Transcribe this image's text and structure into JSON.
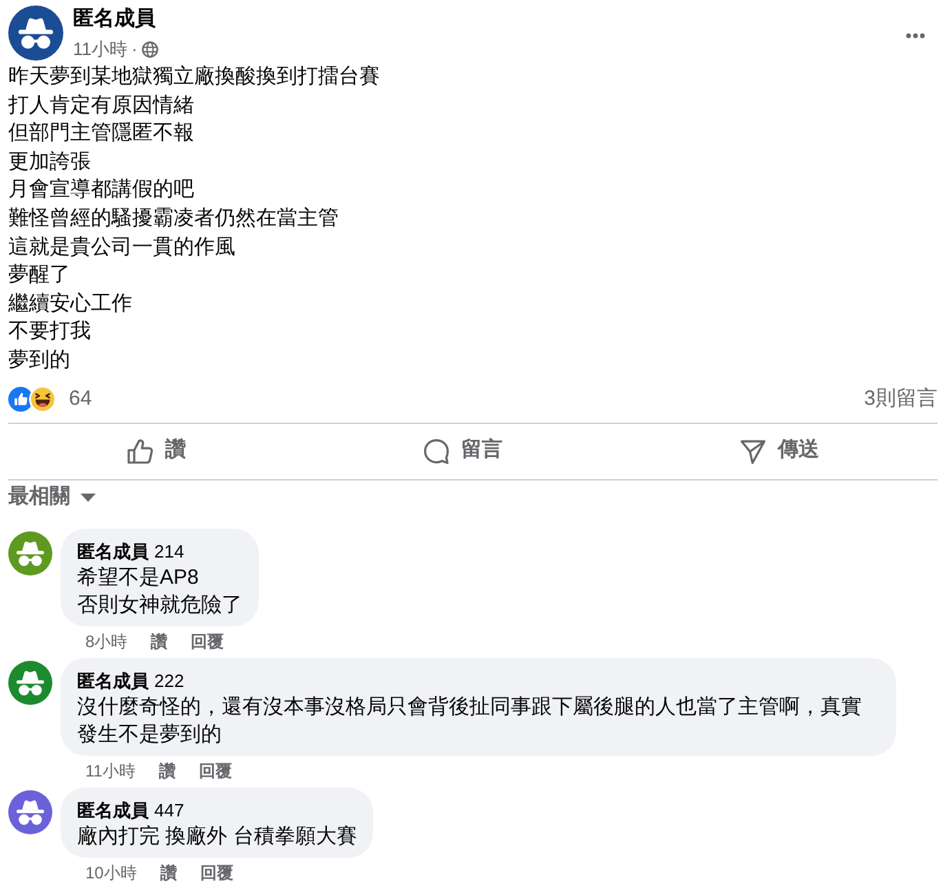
{
  "post": {
    "author": "匿名成員",
    "time": "11小時",
    "separator": "·",
    "lines": [
      "昨天夢到某地獄獨立廠換酸換到打擂台賽",
      "打人肯定有原因情緒",
      "但部門主管隱匿不報",
      "更加誇張",
      "月會宣導都講假的吧",
      "難怪曾經的騷擾霸凌者仍然在當主管",
      "這就是貴公司一貫的作風",
      "夢醒了",
      "繼續安心工作",
      "不要打我",
      "夢到的"
    ],
    "reactions": {
      "icons": [
        {
          "kind": "like"
        },
        {
          "kind": "haha"
        }
      ],
      "count": "64"
    },
    "comments_count": "3則留言"
  },
  "actions": [
    {
      "kind": "like",
      "label": "讚"
    },
    {
      "kind": "comment",
      "label": "留言"
    },
    {
      "kind": "share",
      "label": "傳送"
    }
  ],
  "sort": {
    "label": "最相關"
  },
  "comments": [
    {
      "author": "匿名成員",
      "number": "214",
      "color": "#5d9a1f",
      "lines": [
        "希望不是AP8",
        "否則女神就危險了"
      ],
      "time": "8小時",
      "like": "讚",
      "reply": "回覆"
    },
    {
      "author": "匿名成員",
      "number": "222",
      "color": "#1e8a2e",
      "lines": [
        "沒什麼奇怪的，還有沒本事沒格局只會背後扯同事跟下屬後腿的人也當了主管啊，真實發生不是夢到的"
      ],
      "time": "11小時",
      "like": "讚",
      "reply": "回覆"
    },
    {
      "author": "匿名成員",
      "number": "447",
      "color": "#6b62d9",
      "lines": [
        "廠內打完 換廠外 台積拳願大賽"
      ],
      "time": "10小時",
      "like": "讚",
      "reply": "回覆"
    }
  ]
}
